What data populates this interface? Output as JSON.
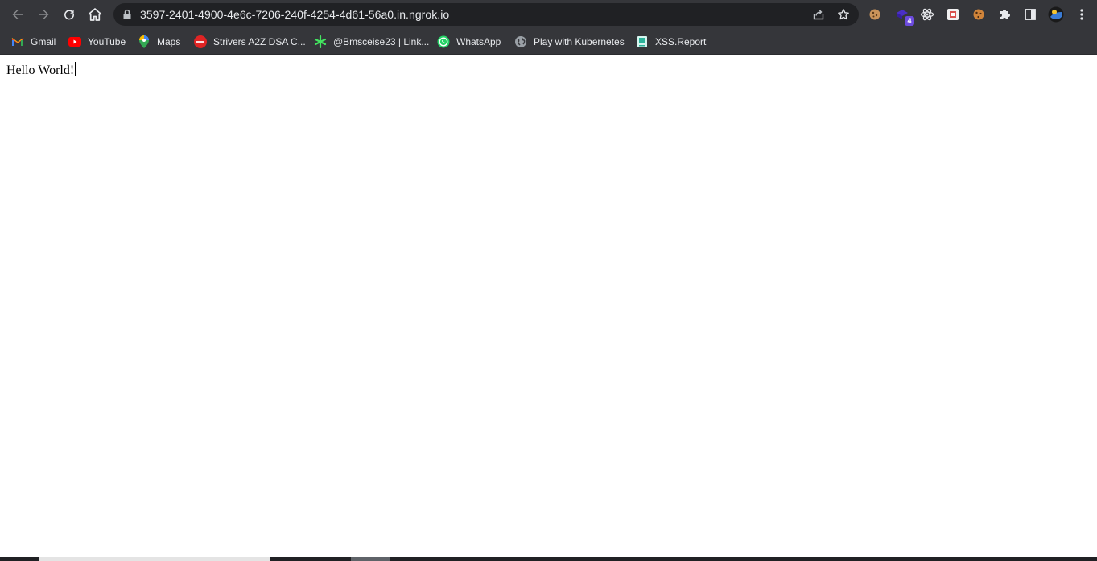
{
  "toolbar": {
    "url": "3597-2401-4900-4e6c-7206-240f-4254-4d61-56a0.in.ngrok.io",
    "back_icon": "back-arrow-icon",
    "forward_icon": "forward-arrow-icon",
    "reload_icon": "reload-icon",
    "home_icon": "home-icon",
    "extensions": [
      {
        "name": "cookie-editor-extension-icon"
      },
      {
        "name": "purple-extension-icon",
        "badge": "4"
      },
      {
        "name": "react-devtools-icon"
      },
      {
        "name": "red-extension-icon"
      },
      {
        "name": "cookie-extension-icon"
      },
      {
        "name": "puzzle-extensions-icon"
      },
      {
        "name": "side-panel-icon"
      },
      {
        "name": "profile-avatar-icon"
      },
      {
        "name": "more-menu-icon"
      }
    ]
  },
  "bookmarks": [
    {
      "label": "Gmail",
      "icon": "gmail-icon"
    },
    {
      "label": "YouTube",
      "icon": "youtube-icon"
    },
    {
      "label": "Maps",
      "icon": "maps-icon"
    },
    {
      "label": "Strivers A2Z DSA C...",
      "icon": "tuf-icon"
    },
    {
      "label": "@Bmsceise23 | Link...",
      "icon": "linktree-icon"
    },
    {
      "label": "WhatsApp",
      "icon": "whatsapp-icon"
    },
    {
      "label": "Play with Kubernetes",
      "icon": "globe-icon"
    },
    {
      "label": "XSS.Report",
      "icon": "xss-report-icon"
    }
  ],
  "page": {
    "text": "Hello World!"
  },
  "colors": {
    "toolbar_bg": "#35363a",
    "omnibox_bg": "#202124",
    "text_light": "#e8eaed",
    "page_bg": "#ffffff"
  }
}
